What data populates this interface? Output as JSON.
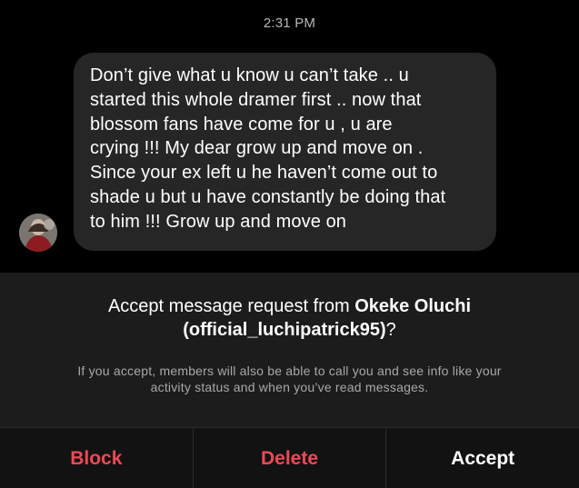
{
  "thread": {
    "timestamp": "2:31 PM",
    "message": {
      "lines": [
        "Don’t give what u know u can’t take .. u",
        "started this whole dramer first .. now that",
        "blossom fans have come for u , u are",
        "crying !!! My dear grow up and move on .",
        "Since your ex left u he haven’t come out to",
        "shade u but u have constantly be doing that",
        "to him !!! Grow up and move on"
      ]
    }
  },
  "request": {
    "title_prefix": "Accept message request from ",
    "sender_name": "Okeke Oluchi",
    "sender_username": "(official_luchipatrick95)",
    "title_suffix": "?",
    "subtitle_line1": "If you accept, members will also be able to call you and see info like your",
    "subtitle_line2": "activity status and when you’ve read messages."
  },
  "actions": {
    "block_label": "Block",
    "delete_label": "Delete",
    "accept_label": "Accept"
  },
  "colors": {
    "background": "#000000",
    "bubble": "#262626",
    "panel": "#1c1c1c",
    "destructive": "#ed4956",
    "muted_text": "#a8a8a8"
  }
}
